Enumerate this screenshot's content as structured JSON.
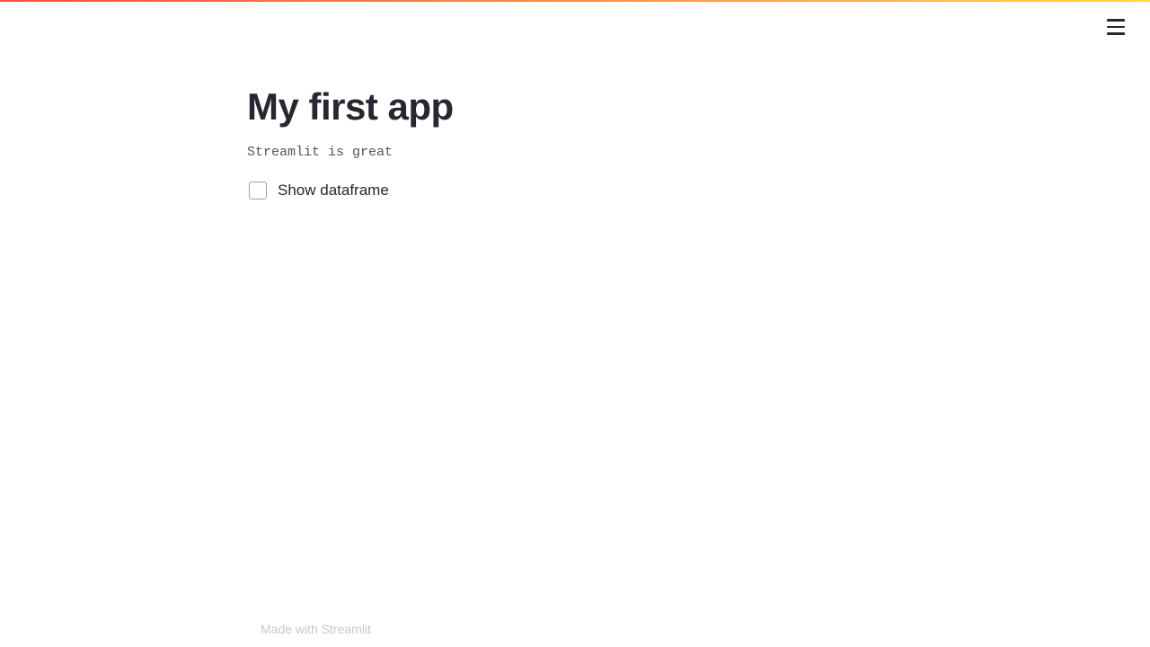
{
  "header": {
    "title": "My first app",
    "subtitle": "Streamlit is great"
  },
  "controls": {
    "checkbox_label": "Show dataframe",
    "checkbox_checked": false
  },
  "footer": {
    "text": "Made with Streamlit"
  }
}
